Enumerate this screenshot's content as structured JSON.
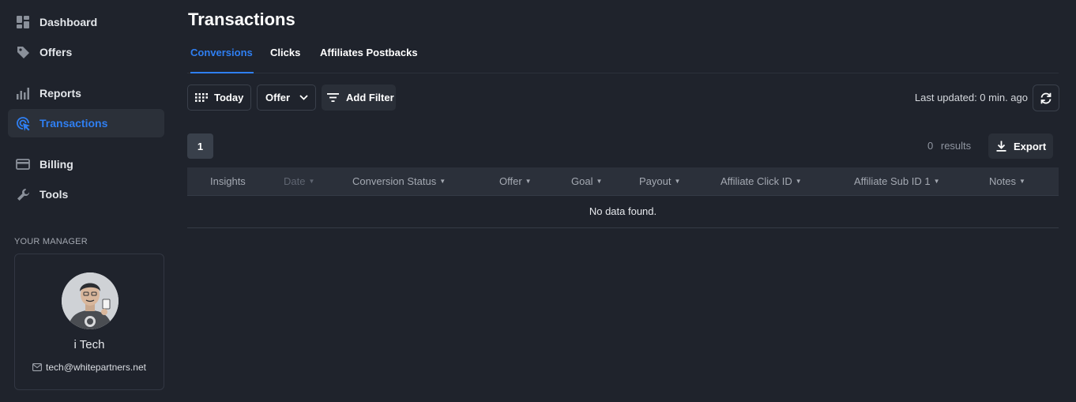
{
  "sidebar": {
    "items": [
      {
        "label": "Dashboard",
        "icon": "dashboard-icon"
      },
      {
        "label": "Offers",
        "icon": "tag-icon"
      },
      {
        "label": "Reports",
        "icon": "bar-chart-icon"
      },
      {
        "label": "Transactions",
        "icon": "cursor-click-icon",
        "active": true
      },
      {
        "label": "Billing",
        "icon": "credit-card-icon"
      },
      {
        "label": "Tools",
        "icon": "wrench-icon"
      }
    ],
    "manager": {
      "section_label": "YOUR MANAGER",
      "name": "i Tech",
      "email": "tech@whitepartners.net"
    }
  },
  "main": {
    "title": "Transactions",
    "tabs": [
      {
        "label": "Conversions",
        "active": true
      },
      {
        "label": "Clicks"
      },
      {
        "label": "Affiliates Postbacks"
      }
    ],
    "toolbar": {
      "date_label": "Today",
      "offer_label": "Offer",
      "add_filter_label": "Add Filter",
      "last_updated": "Last updated: 0 min. ago"
    },
    "pagination": {
      "current_page": "1"
    },
    "results": {
      "count": "0",
      "label": "results"
    },
    "export_label": "Export",
    "table": {
      "columns": [
        "Insights",
        "Date",
        "Conversion Status",
        "Offer",
        "Goal",
        "Payout",
        "Affiliate Click ID",
        "Affiliate Sub ID 1",
        "Notes"
      ],
      "empty_message": "No data found."
    }
  },
  "colors": {
    "background": "#1f232c",
    "accent": "#2f7ff2",
    "header_bg": "#2b303a"
  }
}
